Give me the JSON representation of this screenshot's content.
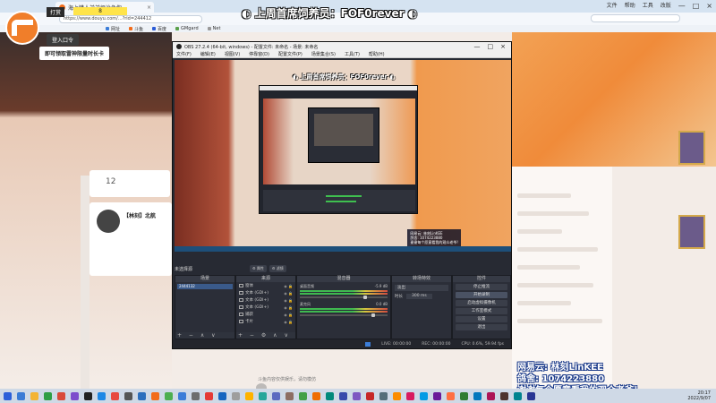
{
  "browser": {
    "tab_title": "海上猎人弟弟惩治急你",
    "tab_close": "×",
    "url": "https://www.douyu.com/...?rid=244412",
    "search_placeholder": "",
    "window_controls": [
      "文件",
      "帮助",
      "工具",
      "改版",
      "—",
      "□",
      "×"
    ],
    "bookmarks": [
      {
        "label": "网址",
        "color": "#3b7dd8"
      },
      {
        "label": "斗鱼",
        "color": "#f26c1a"
      },
      {
        "label": "百度",
        "color": "#2a5bd7"
      },
      {
        "label": "GMgard",
        "color": "#5aa04a"
      },
      {
        "label": "Net",
        "color": "#999999"
      }
    ]
  },
  "meter": {
    "label": "打赏",
    "value": "8"
  },
  "douyu": {
    "signup_label": "登入口令",
    "promo_text": "即可领取雷神限量时长卡",
    "level_number": "12",
    "streamer_name": "【林刻】北航"
  },
  "stream_title": "◐ 上周首席饲养员：FOF0rever ◐",
  "obs": {
    "title": "OBS 27.2.4 (64-bit, windows) - 配置文件: 未命名 - 场景: 未命名",
    "window_ctrls": [
      "—",
      "□",
      "×"
    ],
    "menu": [
      "文件(F)",
      "编辑(E)",
      "视图(V)",
      "停靠窗(D)",
      "配置文件(P)",
      "场景集合(S)",
      "工具(T)",
      "帮助(H)"
    ],
    "preview_title": "◐ 上周首席饲养员：FOF0rever ◐",
    "preview_watermark": [
      "网易云: 林刻LinKEE",
      "鸽舍: 1074223880",
      "谢谢每个愿意看我的观众老爷!"
    ],
    "scene_header": "未选择源",
    "gear_buttons": [
      "⚙ 属性",
      "⚙ 滤镜"
    ],
    "docks": {
      "scenes": {
        "title": "场景",
        "items": [
          "2444132"
        ],
        "footer": "+ − ∧ ∨"
      },
      "sources": {
        "title": "来源",
        "items": [
          {
            "label": "窗体",
            "tail": "◉ 🔒"
          },
          {
            "label": "文本 (GDI+)",
            "tail": "◉ 🔒"
          },
          {
            "label": "文本 (GDI+)",
            "tail": "◉ 🔒"
          },
          {
            "label": "文本 (GDI+)",
            "tail": "◉ 🔒"
          },
          {
            "label": "捕获",
            "tail": "◉ 🔒"
          },
          {
            "label": "卡片",
            "tail": "◉ 🔒"
          }
        ],
        "footer": "+ − ⚙ ∧ ∨"
      },
      "mixer": {
        "title": "混音器",
        "channels": [
          {
            "name": "桌面音频",
            "db": "-5.9 dB",
            "level": 0.72
          },
          {
            "name": "麦克风",
            "db": "0.0 dB",
            "level": 0.82
          }
        ]
      },
      "transitions": {
        "title": "转场特效",
        "selected": "淡出",
        "duration_label": "时长",
        "duration_value": "300 ms"
      },
      "controls": {
        "title": "控件",
        "buttons": [
          "停止推流",
          "开始录制",
          "启动虚拟摄像机",
          "工作室模式",
          "设置",
          "退出"
        ]
      }
    },
    "status": {
      "live": "LIVE: 00:00:00",
      "rec": "REC: 00:00:00",
      "cpu": "CPU: 0.6%, 59.94 fps"
    }
  },
  "overlay": {
    "line1": "网易云: 林刻LinKEE",
    "line2": "鸽舍: 1074223880",
    "line3": "谢谢每个愿意看我的观众老爷！"
  },
  "disclaimer": "斗鱼内容仅供娱乐，请勿模仿",
  "taskbar": {
    "icons": [
      "#2b5fd9",
      "#3a7bd5",
      "#f3b434",
      "#2e9e45",
      "#d94a3a",
      "#7c4dcc",
      "#222222",
      "#1e88e5",
      "#e84a3f",
      "#555555",
      "#2c6fbd",
      "#f26c1a",
      "#4caf50",
      "#3b7dd8",
      "#6d6d6d",
      "#e53935",
      "#1565c0",
      "#9e9e9e",
      "#ffb300",
      "#26a69a",
      "#5c6bc0",
      "#8d6e63",
      "#43a047",
      "#ef6c00",
      "#00897b",
      "#3949ab",
      "#7e57c2",
      "#c62828",
      "#546e7a",
      "#fb8c00",
      "#d81b60",
      "#039be5",
      "#6a1b9a",
      "#ff7043",
      "#2e7d32",
      "#0277bd",
      "#ad1457",
      "#4e342e",
      "#00838f",
      "#283593",
      "#1b5e20",
      "#bf360c",
      "#37474f",
      "#f9a825",
      "#455a64"
    ],
    "time": "20:17",
    "date": "2022/9/07"
  }
}
